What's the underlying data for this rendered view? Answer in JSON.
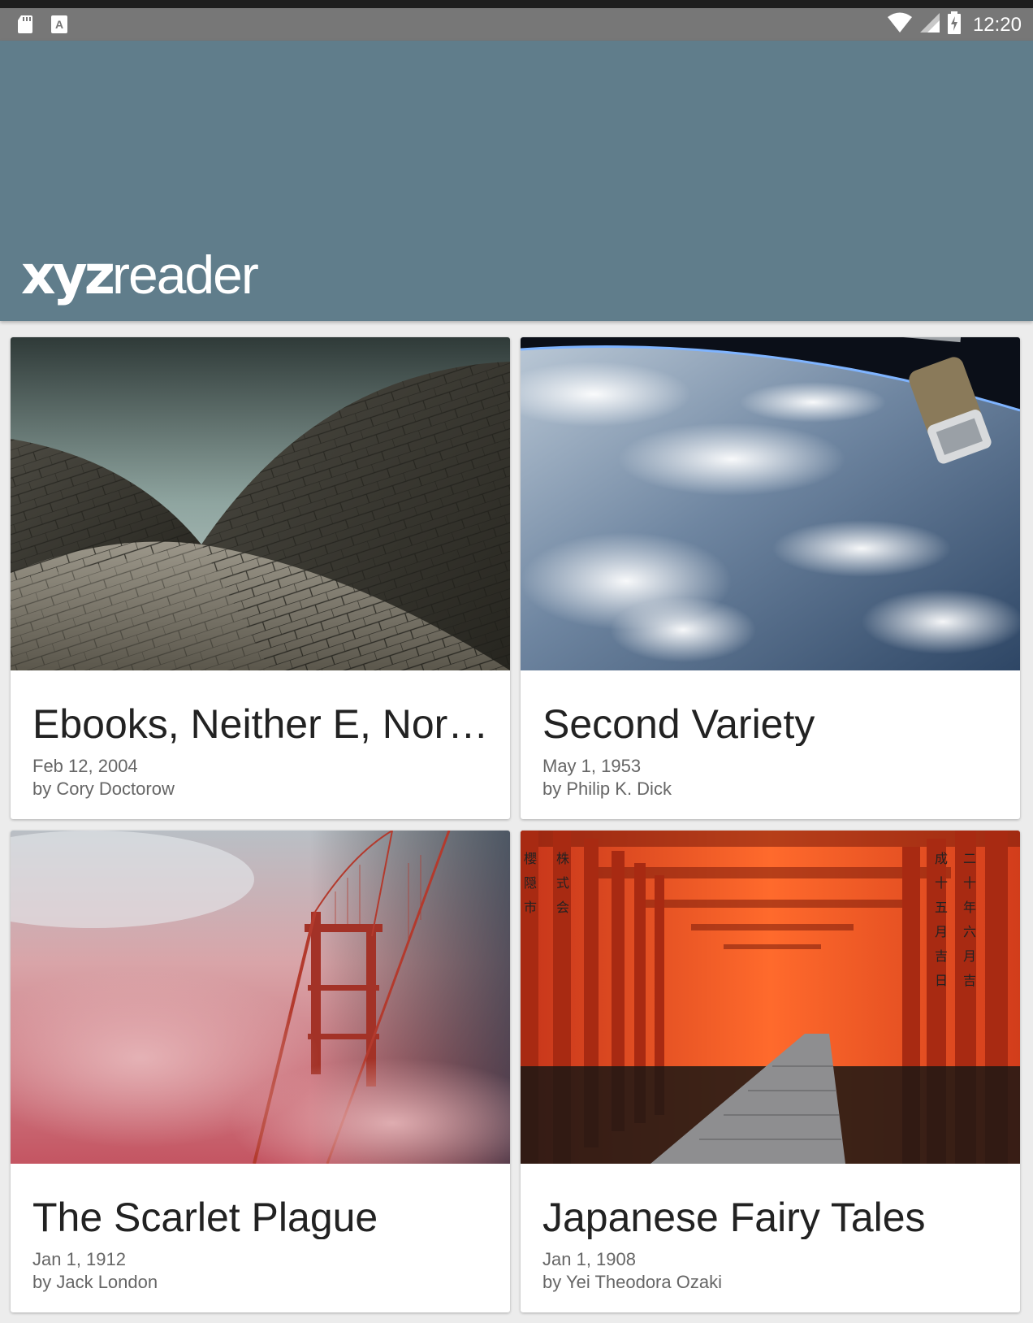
{
  "status_bar": {
    "time": "12:20",
    "left_icons": [
      "sd-card-icon",
      "font-a-icon"
    ],
    "right_icons": [
      "wifi-icon",
      "cell-signal-icon",
      "battery-charging-icon"
    ]
  },
  "app": {
    "logo_bold": "xyz",
    "logo_light": "reader",
    "appbar_color": "#607d8b"
  },
  "articles": [
    {
      "title": "Ebooks, Neither E, Nor Books",
      "date": "Feb 12, 2004",
      "author": "by Cory Doctorow",
      "image": "opera-house-roof-photo"
    },
    {
      "title": "Second Variety",
      "date": "May 1, 1953",
      "author": "by Philip K. Dick",
      "image": "earth-from-space-photo"
    },
    {
      "title": "The Scarlet Plague",
      "date": "Jan 1, 1912",
      "author": "by Jack London",
      "image": "bridge-in-red-fog-photo"
    },
    {
      "title": "Japanese Fairy Tales",
      "date": "Jan 1, 1908",
      "author": "by Yei Theodora Ozaki",
      "image": "torii-gates-path-photo"
    }
  ]
}
